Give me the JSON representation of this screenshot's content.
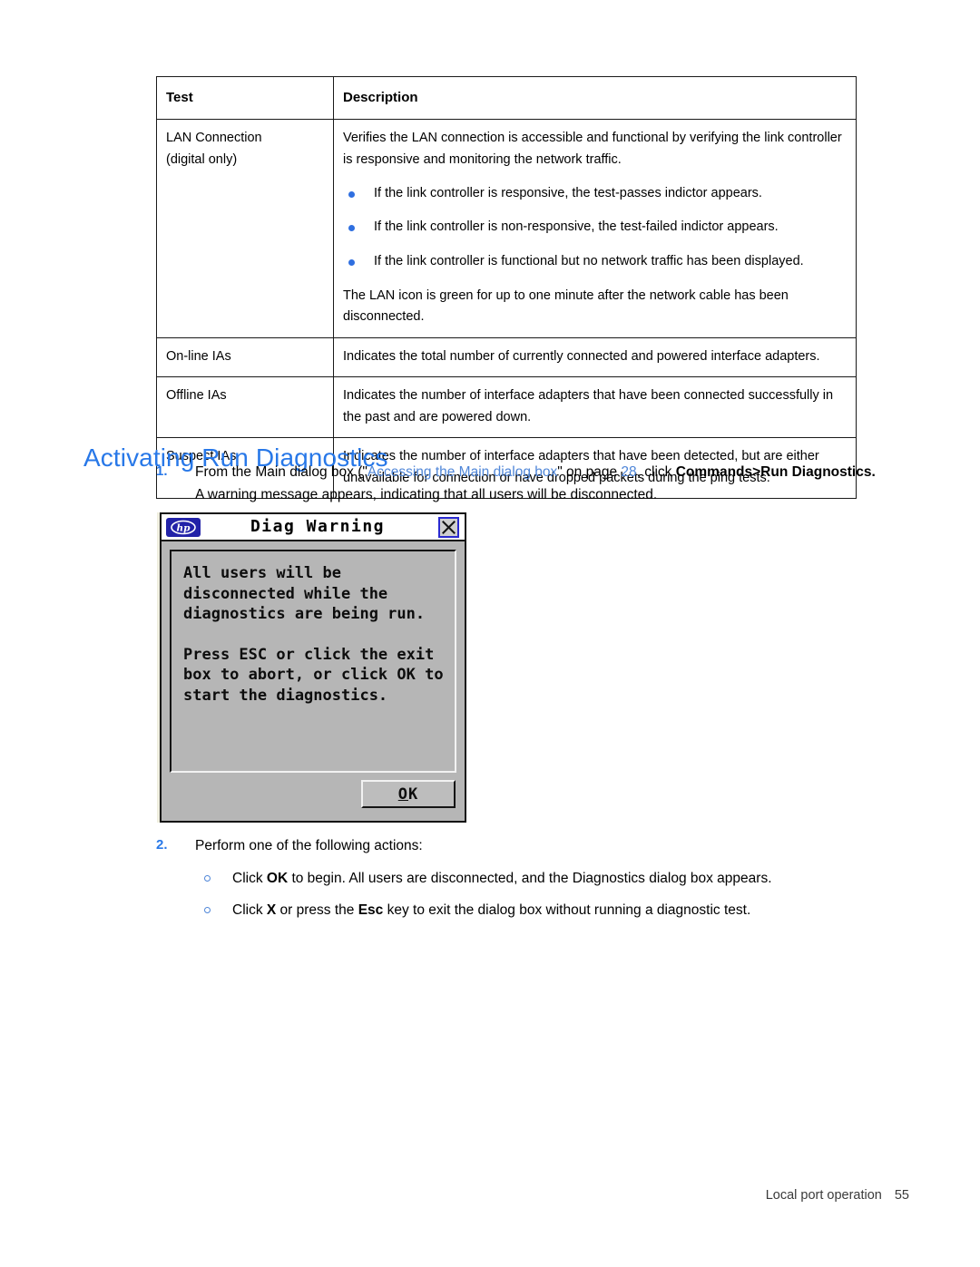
{
  "document": {
    "heading": "Activating Run Diagnostics",
    "footer": {
      "label": "Local port operation",
      "page_number": "55"
    }
  },
  "table": {
    "headers": {
      "test": "Test",
      "description": "Description"
    },
    "rows": [
      {
        "test_line1": "LAN Connection",
        "test_line2": "(digital only)",
        "desc_intro": "Verifies the LAN connection is accessible and functional by verifying the link controller is responsive and monitoring the network traffic.",
        "desc_bullets": [
          "If the link controller is responsive, the test-passes indictor appears.",
          "If the link controller is non-responsive, the test-failed indictor appears.",
          "If the link controller is functional but no network traffic has been displayed."
        ],
        "desc_outro": "The LAN icon is green for up to one minute after the network cable has been disconnected."
      },
      {
        "test": "On-line IAs",
        "description": "Indicates the total number of currently connected and powered interface adapters."
      },
      {
        "test": "Offline IAs",
        "description": "Indicates the number of interface adapters that have been connected successfully in the past and are powered down."
      },
      {
        "test": "Suspect IAs",
        "description": "Indicates the number of interface adapters that have been detected, but are either unavailable for connection or have dropped packets during the ping tests."
      }
    ]
  },
  "steps": {
    "step1": {
      "number": "1.",
      "text_a": "From the Main dialog box (\"",
      "link": "Accessing the Main dialog box",
      "text_b": "\" on page ",
      "page_ref": "28",
      "text_c": ", click ",
      "bold": "Commands>Run Diagnostics.",
      "text_d": " A warning message appears, indicating that all users will be disconnected."
    },
    "step2": {
      "number": "2.",
      "text": "Perform one of the following actions:",
      "options": [
        {
          "text_a": "Click ",
          "bold": "OK",
          "text_b": " to begin. All users are disconnected, and the Diagnostics dialog box appears."
        },
        {
          "text_a": "Click ",
          "bold": "X",
          "text_b": " or press the ",
          "bold2": "Esc",
          "text_c": " key to exit the dialog box without running a diagnostic test."
        }
      ]
    }
  },
  "dialog": {
    "title": "Diag Warning",
    "logo_alt": "hp",
    "close_label": "X",
    "message_part1": "All users will be\ndisconnected while the\ndiagnostics are being run.",
    "message_part2": "Press ESC or click the exit\nbox to abort, or click OK to\nstart the diagnostics.",
    "ok_mnemonic": "O",
    "ok_rest": "K"
  },
  "colors": {
    "heading_blue": "#2878e8",
    "link_blue": "#4f86d8",
    "bullet_blue": "#2f6fe0",
    "dialog_gray": "#b6b6b6",
    "hp_logo_blue": "#2222a8",
    "close_border_blue": "#2a2ad0"
  }
}
